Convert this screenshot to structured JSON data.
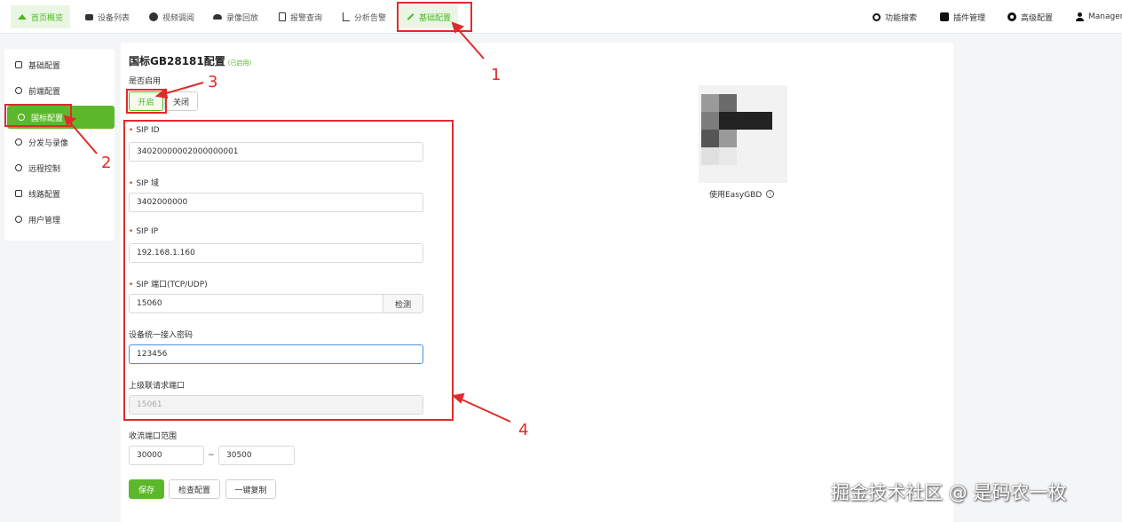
{
  "nav": {
    "items": [
      {
        "label": "首页概览",
        "icon": "home-icon"
      },
      {
        "label": "设备列表",
        "icon": "camera-icon"
      },
      {
        "label": "视频调阅",
        "icon": "play-icon"
      },
      {
        "label": "录像回放",
        "icon": "cloud-icon"
      },
      {
        "label": "报警查询",
        "icon": "document-icon"
      },
      {
        "label": "分析告警",
        "icon": "chart-icon"
      },
      {
        "label": "基础配置",
        "icon": "pencil-icon"
      }
    ],
    "right": [
      {
        "label": "功能搜索",
        "icon": "search-icon"
      },
      {
        "label": "插件管理",
        "icon": "puzzle-icon"
      },
      {
        "label": "高级配置",
        "icon": "gear-icon"
      },
      {
        "label": "Manager",
        "icon": "user-icon"
      }
    ]
  },
  "sidebar": {
    "items": [
      {
        "label": "基础配置"
      },
      {
        "label": "前端配置"
      },
      {
        "label": "国标配置"
      },
      {
        "label": "分发与录像"
      },
      {
        "label": "远程控制"
      },
      {
        "label": "线路配置"
      },
      {
        "label": "用户管理"
      }
    ]
  },
  "form": {
    "title": "国标GB28181配置",
    "title_tag": "(已启用)",
    "enable_label": "是否启用",
    "enable_on": "开启",
    "enable_off": "关闭",
    "sip_id_label": "SIP ID",
    "sip_id_value": "34020000002000000001",
    "sip_domain_label": "SIP 域",
    "sip_domain_value": "3402000000",
    "sip_ip_label": "SIP IP",
    "sip_ip_value": "192.168.1.160",
    "sip_port_label": "SIP 端口(TCP/UDP)",
    "sip_port_value": "15060",
    "detect_label": "检测",
    "password_label": "设备统一接入密码",
    "password_value": "123456",
    "upper_port_label": "上级联请求端口",
    "upper_port_value": "15061",
    "stream_range_label": "收流端口范围",
    "stream_range_from": "30000",
    "stream_range_sep": "~",
    "stream_range_to": "30500",
    "save_label": "保存",
    "check_label": "检查配置",
    "copy_label": "一键复制"
  },
  "qr": {
    "caption": "使用EasyGBD",
    "info_glyph": "i"
  },
  "annotations": {
    "n1": "1",
    "n2": "2",
    "n3": "3",
    "n4": "4",
    "color": "#e02b2b"
  },
  "watermark": "掘金技术社区 @ 是码农一枚",
  "colors": {
    "accent": "#5cb82b",
    "accent_light": "#eaf6e4"
  }
}
